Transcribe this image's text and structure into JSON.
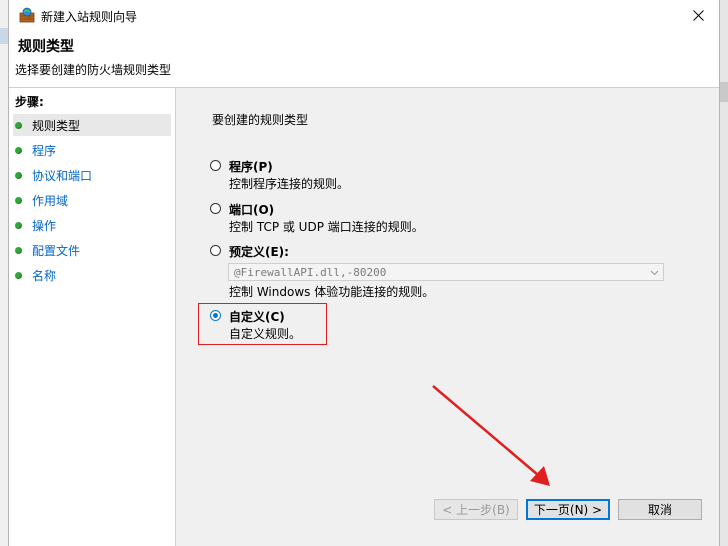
{
  "window": {
    "title": "新建入站规则向导",
    "close_icon": "close-icon"
  },
  "header": {
    "title": "规则类型",
    "subtitle": "选择要创建的防火墙规则类型"
  },
  "steps": {
    "label": "步骤:",
    "items": [
      {
        "label": "规则类型",
        "active": true
      },
      {
        "label": "程序",
        "active": false
      },
      {
        "label": "协议和端口",
        "active": false
      },
      {
        "label": "作用域",
        "active": false
      },
      {
        "label": "操作",
        "active": false
      },
      {
        "label": "配置文件",
        "active": false
      },
      {
        "label": "名称",
        "active": false
      }
    ]
  },
  "main": {
    "prompt": "要创建的规则类型",
    "options": [
      {
        "label": "程序(P)",
        "desc": "控制程序连接的规则。",
        "checked": false
      },
      {
        "label": "端口(O)",
        "desc": "控制 TCP 或 UDP 端口连接的规则。",
        "checked": false
      },
      {
        "label": "预定义(E):",
        "desc": "控制 Windows 体验功能连接的规则。",
        "checked": false
      },
      {
        "label": "自定义(C)",
        "desc": "自定义规则。",
        "checked": true
      }
    ],
    "predefined_select_value": "@FirewallAPI.dll,-80200"
  },
  "buttons": {
    "back": "< 上一步(B)",
    "next": "下一页(N) >",
    "cancel": "取消"
  },
  "colors": {
    "accent": "#0078d7",
    "annotation": "#e02020",
    "step_dot": "#2fa83a",
    "link": "#0066cc"
  }
}
